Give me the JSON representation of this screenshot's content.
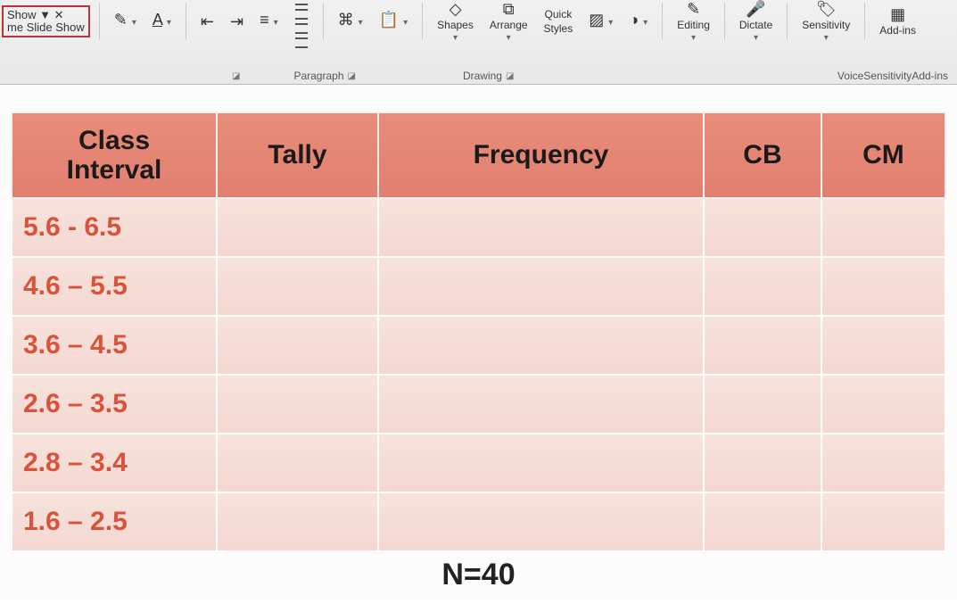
{
  "ribbon": {
    "slideShow": {
      "line1": "Show ▼ ✕",
      "line2": "me Slide Show"
    },
    "groups": {
      "paragraph": "Paragraph",
      "drawing": "Drawing",
      "voice": "Voice",
      "sensitivity": "Sensitivity",
      "addins": "Add-ins"
    },
    "buttons": {
      "shapes": "Shapes",
      "arrange": "Arrange",
      "quick": "Quick",
      "styles": "Styles",
      "editing": "Editing",
      "dictate": "Dictate",
      "sensitivity": "Sensitivity",
      "addins": "Add-ins"
    }
  },
  "table": {
    "headers": [
      "Class Interval",
      "Tally",
      "Frequency",
      "CB",
      "CM"
    ],
    "rows": [
      {
        "interval": "5.6 - 6.5",
        "tally": "",
        "frequency": "",
        "cb": "",
        "cm": ""
      },
      {
        "interval": "4.6 – 5.5",
        "tally": "",
        "frequency": "",
        "cb": "",
        "cm": ""
      },
      {
        "interval": "3.6 – 4.5",
        "tally": "",
        "frequency": "",
        "cb": "",
        "cm": ""
      },
      {
        "interval": "2.6 – 3.5",
        "tally": "",
        "frequency": "",
        "cb": "",
        "cm": ""
      },
      {
        "interval": "2.8 – 3.4",
        "tally": "",
        "frequency": "",
        "cb": "",
        "cm": ""
      },
      {
        "interval": "1.6 – 2.5",
        "tally": "",
        "frequency": "",
        "cb": "",
        "cm": ""
      }
    ]
  },
  "footer": {
    "n": "N=40"
  }
}
